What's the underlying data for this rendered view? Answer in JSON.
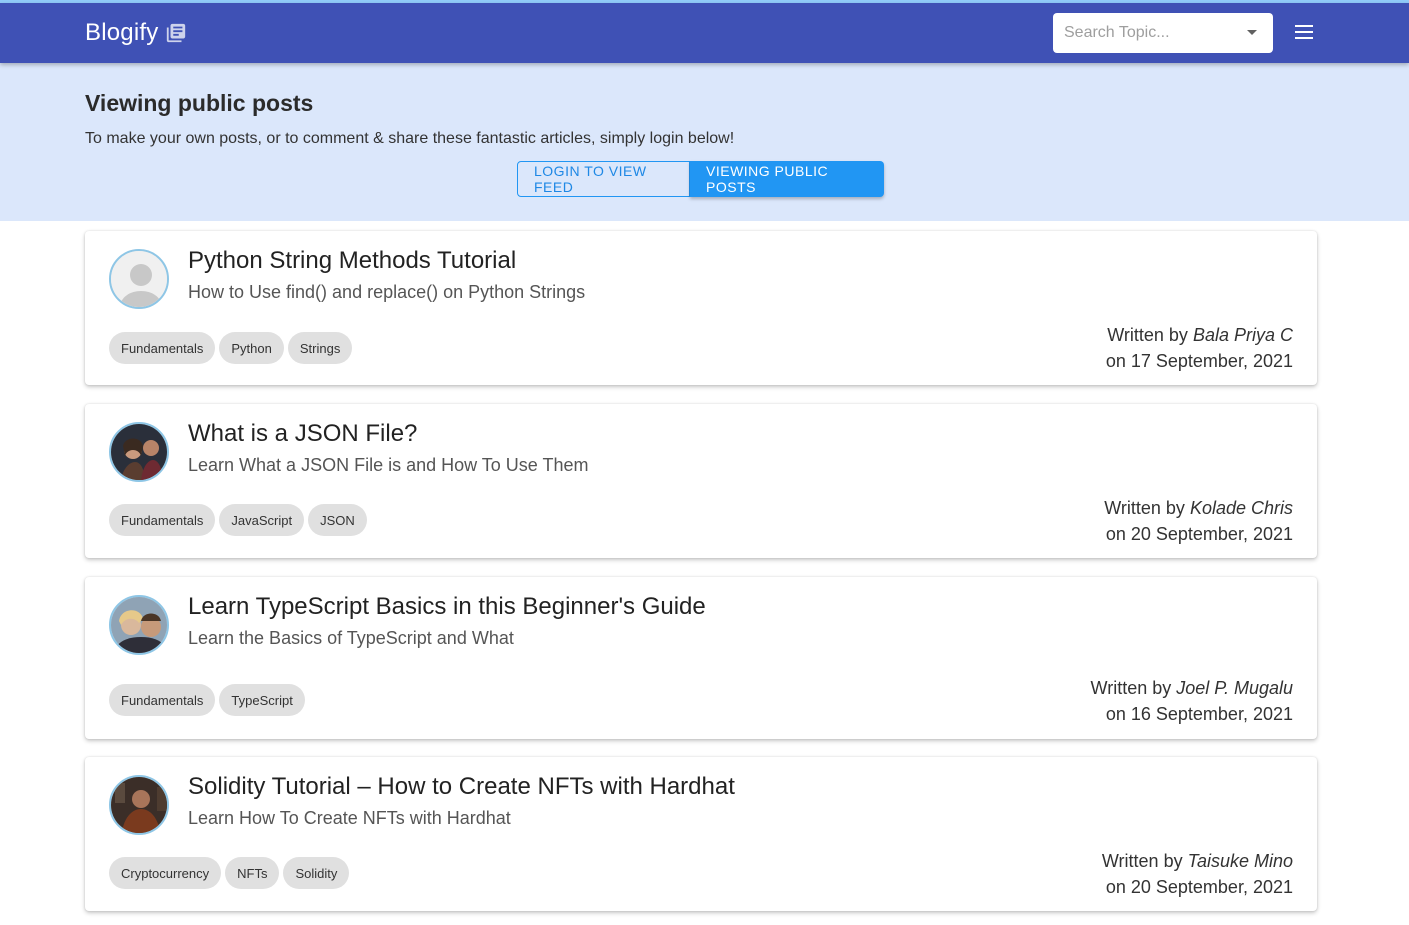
{
  "app": {
    "title": "Blogify"
  },
  "search": {
    "placeholder": "Search Topic..."
  },
  "hero": {
    "heading": "Viewing public posts",
    "text": "To make your own posts, or to comment & share these fantastic articles, simply login below!",
    "login_label": "LOGIN TO VIEW FEED",
    "public_label": "VIEWING PUBLIC POSTS"
  },
  "colors": {
    "appbar": "#3f51b5",
    "hero_bg": "#dbe7fb",
    "accent": "#2196f3"
  },
  "posts": [
    {
      "title": "Python String Methods Tutorial",
      "subtitle": "How to Use find() and replace() on Python Strings",
      "tags": [
        "Fundamentals",
        "Python",
        "Strings"
      ],
      "written_by": "Written by",
      "author": "Bala Priya C",
      "date": "on 17 September, 2021"
    },
    {
      "title": "What is a JSON File?",
      "subtitle": "Learn What a JSON File is and How To Use Them",
      "tags": [
        "Fundamentals",
        "JavaScript",
        "JSON"
      ],
      "written_by": "Written by",
      "author": "Kolade Chris",
      "date": "on 20 September, 2021"
    },
    {
      "title": "Learn TypeScript Basics in this Beginner's Guide",
      "subtitle": "Learn the Basics of TypeScript and What",
      "tags": [
        "Fundamentals",
        "TypeScript"
      ],
      "written_by": "Written by",
      "author": "Joel P. Mugalu",
      "date": "on 16 September, 2021"
    },
    {
      "title": "Solidity Tutorial – How to Create NFTs with Hardhat",
      "subtitle": "Learn How To Create NFTs with Hardhat",
      "tags": [
        "Cryptocurrency",
        "NFTs",
        "Solidity"
      ],
      "written_by": "Written by",
      "author": "Taisuke Mino",
      "date": "on 20 September, 2021"
    }
  ]
}
